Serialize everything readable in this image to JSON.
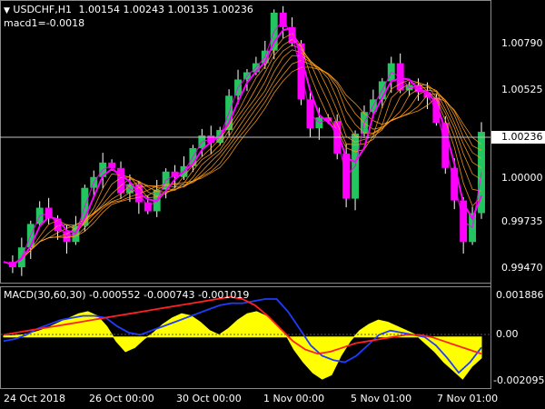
{
  "window": {
    "symbol_timeframe": "USDCHF,H1",
    "ohlc": "1.00154 1.00243 1.00135 1.00236",
    "indicator_readout": "macd1=-0.0018"
  },
  "price_panel": {
    "y_ticks": [
      "1.00790",
      "1.00525",
      "1.00236",
      "1.00000",
      "0.99735",
      "0.99470"
    ],
    "current_price": "1.00236"
  },
  "macd_panel": {
    "label": "MACD(30,60,30) -0.000552 -0.000743 -0.001019",
    "y_ticks": [
      "0.001886",
      "0.00",
      "-0.002095"
    ]
  },
  "x_axis": {
    "ticks": [
      "24 Oct 2018",
      "26 Oct 00:00",
      "30 Oct 00:00",
      "1 Nov 00:00",
      "5 Nov 01:00",
      "7 Nov 01:00"
    ]
  },
  "colors": {
    "background": "#000000",
    "up_candle": "#22c55e",
    "down_candle": "#ff00ff",
    "ma_fast": "#ff00ff",
    "ma_ribbon": "#ff9f1c",
    "macd_hist": "#ffff00",
    "macd_line": "#1f3cff",
    "signal_line": "#ff2020"
  },
  "chart_data": {
    "type": "candlestick",
    "price_axis": {
      "min": 0.9942,
      "max": 1.0093
    },
    "macd_axis": {
      "min": -0.0023,
      "max": 0.0021
    },
    "close_series": [
      0.9951,
      0.9948,
      0.9959,
      0.9972,
      0.9981,
      0.9975,
      0.9968,
      0.9962,
      0.9971,
      0.9992,
      0.9998,
      1.0006,
      1.0003,
      0.9989,
      0.9994,
      0.9984,
      0.9979,
      0.9991,
      1.0001,
      0.9998,
      1.0004,
      1.0014,
      1.0021,
      1.0017,
      1.0024,
      1.0043,
      1.0052,
      1.0056,
      1.0061,
      1.0068,
      1.0089,
      1.0081,
      1.0072,
      1.0041,
      1.0025,
      1.0031,
      1.0029,
      1.0011,
      0.9986,
      1.0022,
      1.0034,
      1.0041,
      1.0051,
      1.0061,
      1.0046,
      1.0049,
      1.0045,
      1.0042,
      1.0028,
      1.0003,
      0.9985,
      0.9962,
      0.9978,
      1.0023
    ],
    "macd_hist": [
      5e-05,
      6e-05,
      0.0001,
      0.00018,
      0.00032,
      0.0005,
      0.0007,
      0.0009,
      0.0011,
      0.0012,
      0.001,
      0.0005,
      -0.0002,
      -0.0007,
      -0.0005,
      -0.0001,
      0.0002,
      0.0006,
      0.0009,
      0.0011,
      0.001,
      0.0007,
      0.0003,
      0.0001,
      0.0004,
      0.0008,
      0.0011,
      0.0012,
      0.001,
      0.0006,
      0.0002,
      -0.0006,
      -0.0012,
      -0.0017,
      -0.002,
      -0.0018,
      -0.0009,
      -0.0002,
      0.0003,
      0.0006,
      0.0008,
      0.0007,
      0.0005,
      0.0003,
      0.0001,
      -0.0003,
      -0.0007,
      -0.0012,
      -0.0016,
      -0.002,
      -0.0014,
      -0.001
    ],
    "macd_line": [
      -0.0002,
      -0.0001,
      0.0001,
      0.0004,
      0.0006,
      0.0008,
      0.0009,
      0.001,
      0.001,
      0.0009,
      0.0005,
      0.0002,
      0.0001,
      0.0003,
      0.0005,
      0.0007,
      0.0009,
      0.0011,
      0.0013,
      0.0015,
      0.0016,
      0.0016,
      0.0017,
      0.0018,
      0.0018,
      0.0012,
      0.0004,
      -0.0004,
      -0.0009,
      -0.0011,
      -0.0012,
      -0.0009,
      -0.0004,
      0.0001,
      0.0003,
      0.0002,
      0.0001,
      0.0,
      -0.0004,
      -0.001,
      -0.0017,
      -0.0012,
      -0.0005
    ],
    "signal_line": [
      0.0001,
      0.0002,
      0.0003,
      0.0004,
      0.0005,
      0.0006,
      0.0007,
      0.0008,
      0.0009,
      0.001,
      0.0011,
      0.0012,
      0.0013,
      0.0014,
      0.0015,
      0.0016,
      0.0017,
      0.0018,
      0.0019,
      0.0018,
      0.0015,
      0.001,
      0.0004,
      -0.0002,
      -0.0006,
      -0.0008,
      -0.0007,
      -0.0005,
      -0.0003,
      -0.0002,
      -0.0001,
      0.0,
      0.0001,
      0.0001,
      0.0,
      -0.0002,
      -0.0004,
      -0.0006,
      -0.0008
    ]
  }
}
